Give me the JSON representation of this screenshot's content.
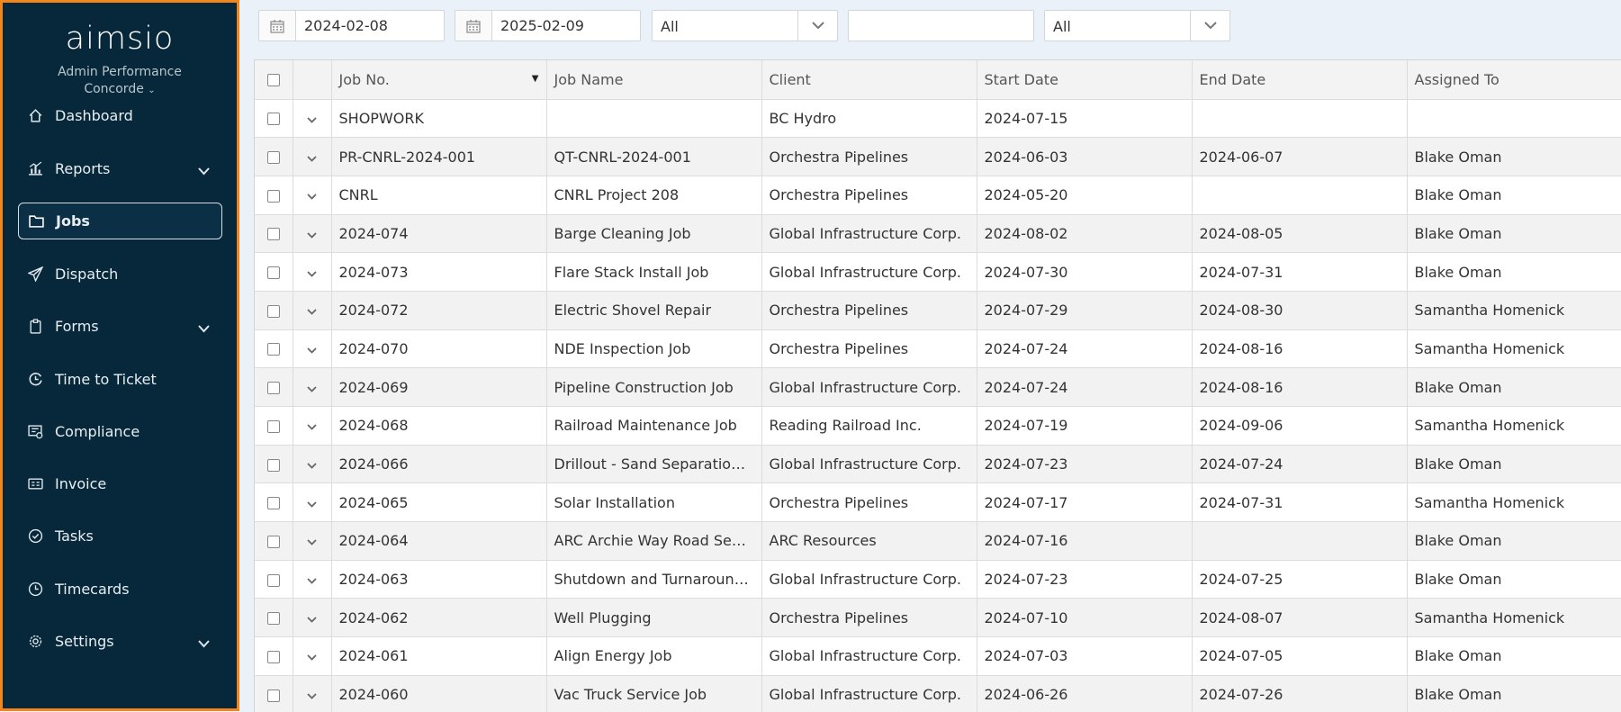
{
  "sidebar": {
    "logo": "aimsio",
    "org_line1": "Admin Performance",
    "org_line2": "Concorde",
    "items": [
      {
        "label": "Dashboard",
        "icon": "home-icon",
        "has_caret": false,
        "active": false
      },
      {
        "label": "Reports",
        "icon": "bar-chart-icon",
        "has_caret": true,
        "active": false
      },
      {
        "label": "Jobs",
        "icon": "folder-icon",
        "has_caret": false,
        "active": true
      },
      {
        "label": "Dispatch",
        "icon": "paper-plane-icon",
        "has_caret": false,
        "active": false
      },
      {
        "label": "Forms",
        "icon": "clipboard-icon",
        "has_caret": true,
        "active": false
      },
      {
        "label": "Time to Ticket",
        "icon": "time-to-ticket-icon",
        "has_caret": false,
        "active": false
      },
      {
        "label": "Compliance",
        "icon": "compliance-icon",
        "has_caret": false,
        "active": false
      },
      {
        "label": "Invoice",
        "icon": "invoice-icon",
        "has_caret": false,
        "active": false
      },
      {
        "label": "Tasks",
        "icon": "check-circle-icon",
        "has_caret": false,
        "active": false
      },
      {
        "label": "Timecards",
        "icon": "clock-icon",
        "has_caret": false,
        "active": false
      },
      {
        "label": "Settings",
        "icon": "gear-icon",
        "has_caret": true,
        "active": false
      }
    ]
  },
  "filters": {
    "start_date": "2024-02-08",
    "end_date": "2025-02-09",
    "select1": "All",
    "text_value": "",
    "select2": "All"
  },
  "table": {
    "columns": [
      "Job No.",
      "Job Name",
      "Client",
      "Start Date",
      "End Date",
      "Assigned To"
    ],
    "rows": [
      [
        "SHOPWORK",
        "",
        "BC Hydro",
        "2024-07-15",
        "",
        ""
      ],
      [
        "PR-CNRL-2024-001",
        "QT-CNRL-2024-001",
        "Orchestra Pipelines",
        "2024-06-03",
        "2024-06-07",
        "Blake Oman"
      ],
      [
        "CNRL",
        "CNRL Project 208",
        "Orchestra Pipelines",
        "2024-05-20",
        "",
        "Blake Oman"
      ],
      [
        "2024-074",
        "Barge Cleaning Job",
        "Global Infrastructure Corp.",
        "2024-08-02",
        "2024-08-05",
        "Blake Oman"
      ],
      [
        "2024-073",
        "Flare Stack Install Job",
        "Global Infrastructure Corp.",
        "2024-07-30",
        "2024-07-31",
        "Blake Oman"
      ],
      [
        "2024-072",
        "Electric Shovel Repair",
        "Orchestra Pipelines",
        "2024-07-29",
        "2024-08-30",
        "Samantha Homenick"
      ],
      [
        "2024-070",
        "NDE Inspection Job",
        "Orchestra Pipelines",
        "2024-07-24",
        "2024-08-16",
        "Samantha Homenick"
      ],
      [
        "2024-069",
        "Pipeline Construction Job",
        "Global Infrastructure Corp.",
        "2024-07-24",
        "2024-08-16",
        "Blake Oman"
      ],
      [
        "2024-068",
        "Railroad Maintenance Job",
        "Reading Railroad Inc.",
        "2024-07-19",
        "2024-09-06",
        "Samantha Homenick"
      ],
      [
        "2024-066",
        "Drillout - Sand Separation Job",
        "Global Infrastructure Corp.",
        "2024-07-23",
        "2024-07-24",
        "Blake Oman"
      ],
      [
        "2024-065",
        "Solar Installation",
        "Orchestra Pipelines",
        "2024-07-17",
        "2024-07-31",
        "Samantha Homenick"
      ],
      [
        "2024-064",
        "ARC Archie Way Road Security",
        "ARC Resources",
        "2024-07-16",
        "",
        "Blake Oman"
      ],
      [
        "2024-063",
        "Shutdown and Turnaround Job",
        "Global Infrastructure Corp.",
        "2024-07-23",
        "2024-07-25",
        "Blake Oman"
      ],
      [
        "2024-062",
        "Well Plugging",
        "Orchestra Pipelines",
        "2024-07-10",
        "2024-08-07",
        "Samantha Homenick"
      ],
      [
        "2024-061",
        "Align Energy Job",
        "Global Infrastructure Corp.",
        "2024-07-03",
        "2024-07-05",
        "Blake Oman"
      ],
      [
        "2024-060",
        "Vac Truck Service Job",
        "Global Infrastructure Corp.",
        "2024-06-26",
        "2024-07-26",
        "Blake Oman"
      ]
    ]
  },
  "colors": {
    "sidebar_bg": "#07283a",
    "sidebar_border": "#f0861c",
    "page_bg": "#ebf1f8"
  }
}
